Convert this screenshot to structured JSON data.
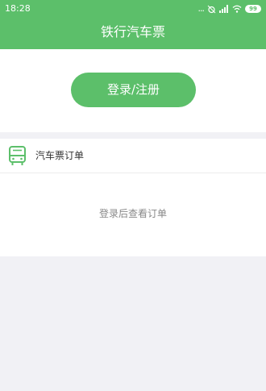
{
  "status_bar": {
    "time": "18:28",
    "dots": "...",
    "battery": "99"
  },
  "header": {
    "title": "铁行汽车票"
  },
  "login": {
    "button_label": "登录/注册"
  },
  "orders": {
    "icon": "bus-icon",
    "title": "汽车票订单",
    "empty_text": "登录后查看订单"
  },
  "colors": {
    "brand_green": "#5cbf6a",
    "background": "#f1f1f5"
  }
}
